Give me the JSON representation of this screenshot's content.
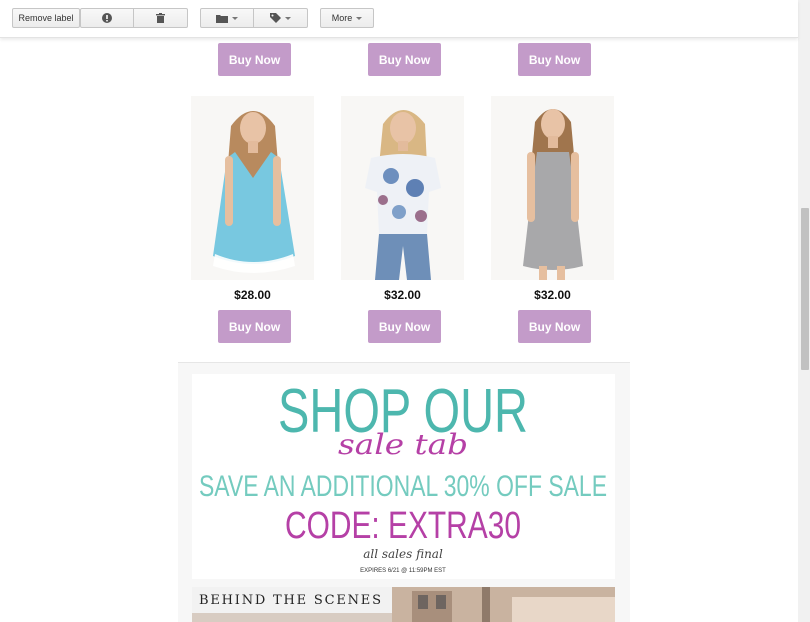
{
  "toolbar": {
    "remove_label": "Remove label",
    "report_icon": "exclamation-icon",
    "delete_icon": "trash-icon",
    "move_icon": "folder-icon",
    "labels_icon": "tag-icon",
    "more_label": "More"
  },
  "email": {
    "buy_label": "Buy Now",
    "accent_color": "#c39bc9",
    "products": [
      {
        "price": "$28.00",
        "description": "Woman in sky blue v-neck tank with lace hem"
      },
      {
        "price": "$32.00",
        "description": "Woman in white floral off-shoulder top and jeans"
      },
      {
        "price": "$32.00",
        "description": "Woman in heather grey sleeveless swing dress"
      }
    ],
    "promo": {
      "line1": "SHOP OUR",
      "line2": "sale tab",
      "line3": "SAVE AN ADDITIONAL 30% OFF SALE",
      "line4": "CODE: EXTRA30",
      "line5": "all sales final",
      "line6": "EXPIRES 6/21 @ 11:59PM EST",
      "teal": "#4db7ae",
      "magenta": "#b540a6"
    },
    "behind_title": "BEHIND THE SCENES"
  }
}
